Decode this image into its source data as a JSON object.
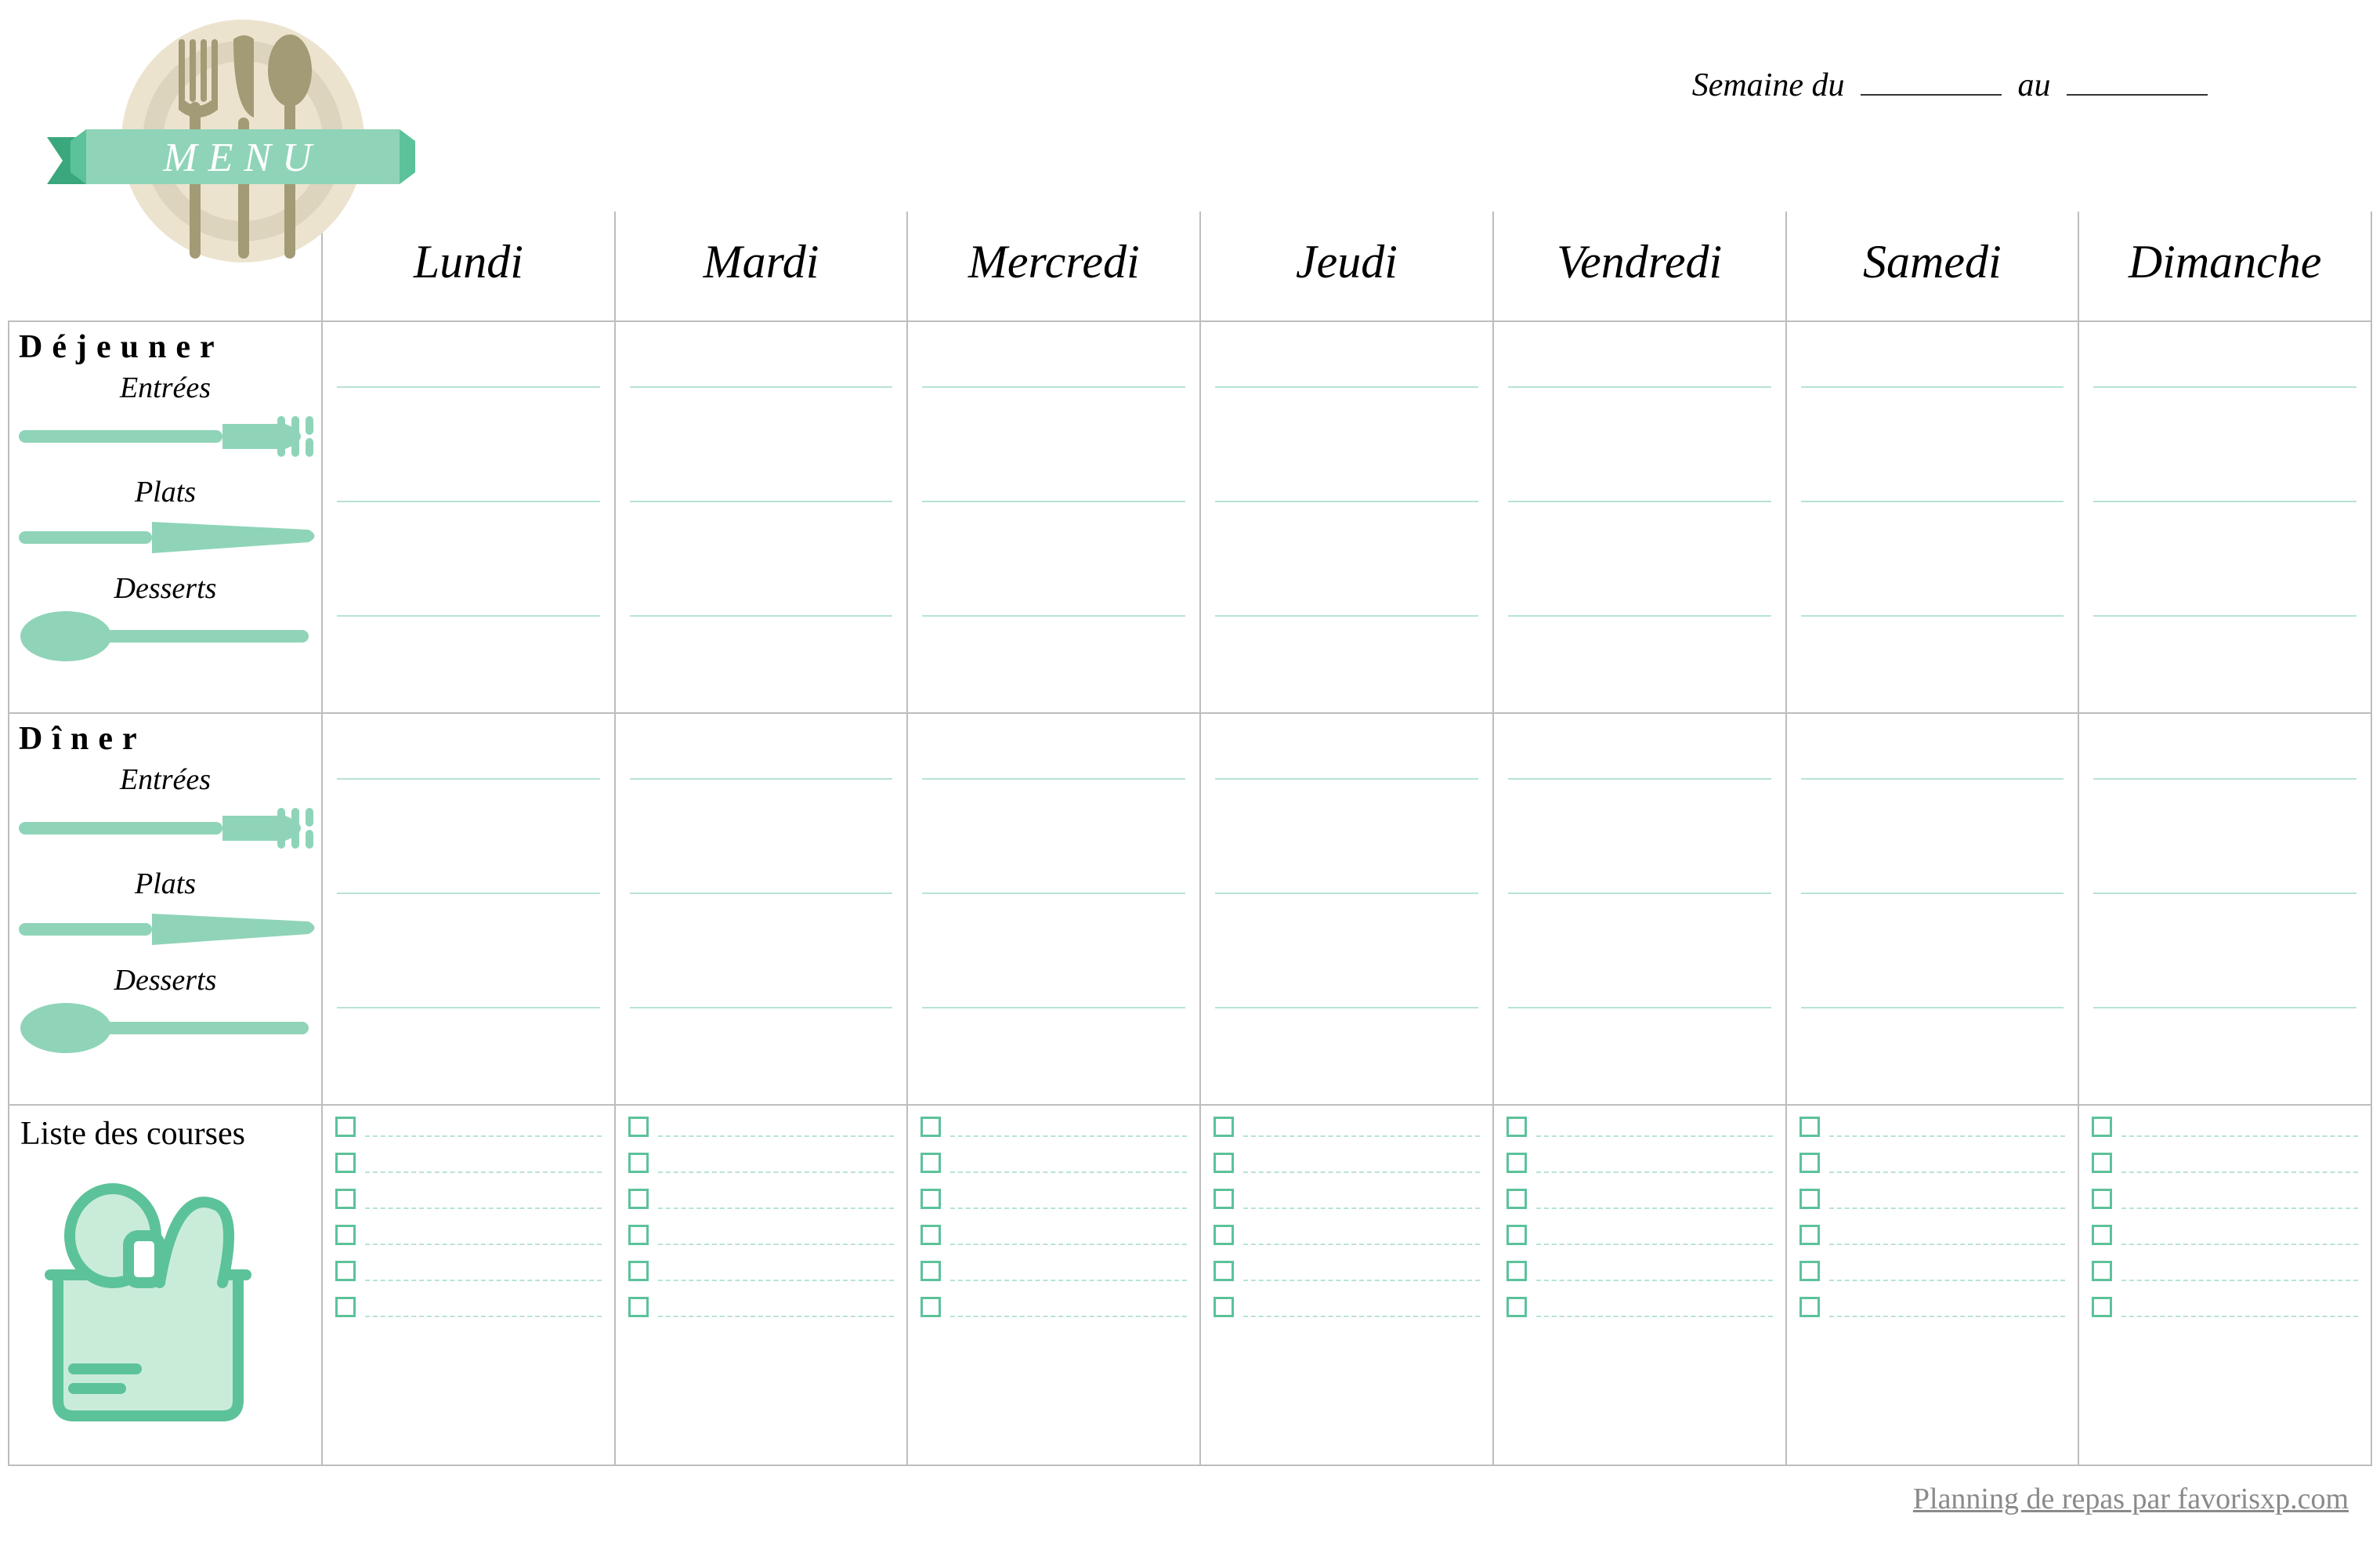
{
  "logo_text": "MENU",
  "week": {
    "prefix": "Semaine du",
    "middle": "au"
  },
  "days": [
    "Lundi",
    "Mardi",
    "Mercredi",
    "Jeudi",
    "Vendredi",
    "Samedi",
    "Dimanche"
  ],
  "meals": {
    "lunch": {
      "title": "Déjeuner",
      "courses": [
        "Entrées",
        "Plats",
        "Desserts"
      ]
    },
    "dinner": {
      "title": "Dîner",
      "courses": [
        "Entrées",
        "Plats",
        "Desserts"
      ]
    }
  },
  "shopping": {
    "title": "Liste des courses",
    "rows_per_day": 6
  },
  "footer": "Planning de repas par favorisxp.com",
  "colors": {
    "accent": "#5cc29a",
    "accent_light": "#8fd4b8",
    "plate": "#ece3cf",
    "plate_inner": "#ddd4bd",
    "utensil": "#a39a76"
  }
}
